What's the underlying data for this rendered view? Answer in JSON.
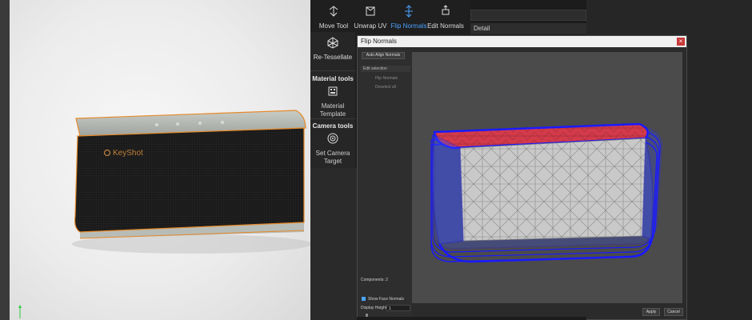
{
  "toolbar": {
    "tools": [
      {
        "label": "Move Tool",
        "icon": "move-icon"
      },
      {
        "label": "Unwrap UV",
        "icon": "unwrap-uv-icon"
      },
      {
        "label": "Flip Normals",
        "icon": "flip-normals-icon",
        "active": true
      },
      {
        "label": "Edit Normals",
        "icon": "edit-normals-icon"
      }
    ],
    "retessellate_label": "Re-Tessellate",
    "material_section": "Material tools",
    "material_template_label": "Material Template",
    "camera_section": "Camera tools",
    "camera_target_label": "Set Camera Target"
  },
  "right_panel": {
    "detail_label": "Detail"
  },
  "viewport": {
    "brand_logo": "KeyShot"
  },
  "dialog": {
    "title": "Flip Normals",
    "auto_align_label": "Auto Align Normals",
    "edit_selection_label": "Edit selection",
    "flip_normals_item": "Flip Normals",
    "deselect_all_item": "Deselect all",
    "components_label": "Components: 2",
    "show_face_normals_label": "Show Face Normals",
    "display_height_label": "Display Height",
    "display_height_value": "1",
    "apply_label": "Apply",
    "cancel_label": "Cancel"
  },
  "colors": {
    "accent": "#4aa3ff",
    "selection_outline": "#e58a2a",
    "normal_flipped": "#d33a4a",
    "mesh_outline": "#1a1aff"
  }
}
